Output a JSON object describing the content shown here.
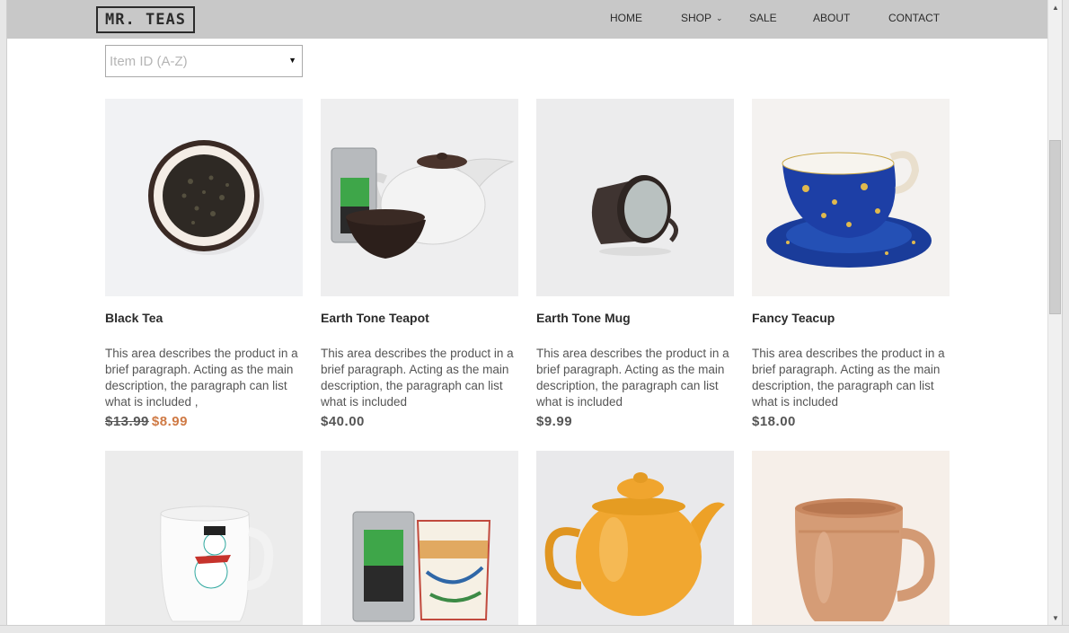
{
  "header": {
    "logo": "MR. TEAS",
    "nav": [
      {
        "label": "HOME"
      },
      {
        "label": "SHOP",
        "has_dropdown": true
      },
      {
        "label": "SALE"
      },
      {
        "label": "ABOUT"
      },
      {
        "label": "CONTACT"
      }
    ]
  },
  "sort": {
    "placeholder": "Item ID (A-Z)"
  },
  "products": [
    {
      "name": "Black Tea",
      "description": "This area describes the product in a brief paragraph. Acting as the main description, the paragraph can list what is included ,",
      "old_price": "$13.99",
      "price": "$8.99"
    },
    {
      "name": "Earth Tone Teapot",
      "description": "This area describes the product in a brief paragraph. Acting as the main description, the paragraph can list what is included",
      "price": "$40.00"
    },
    {
      "name": "Earth Tone Mug",
      "description": "This area describes the product in a brief paragraph. Acting as the main description, the paragraph can list what is included",
      "price": "$9.99"
    },
    {
      "name": "Fancy Teacup",
      "description": "This area describes the product in a brief paragraph. Acting as the main description, the paragraph can list what is included",
      "price": "$18.00"
    }
  ],
  "colors": {
    "header_bg": "#c8c8c8",
    "sale_price": "#cf7a45",
    "text": "#555555"
  }
}
